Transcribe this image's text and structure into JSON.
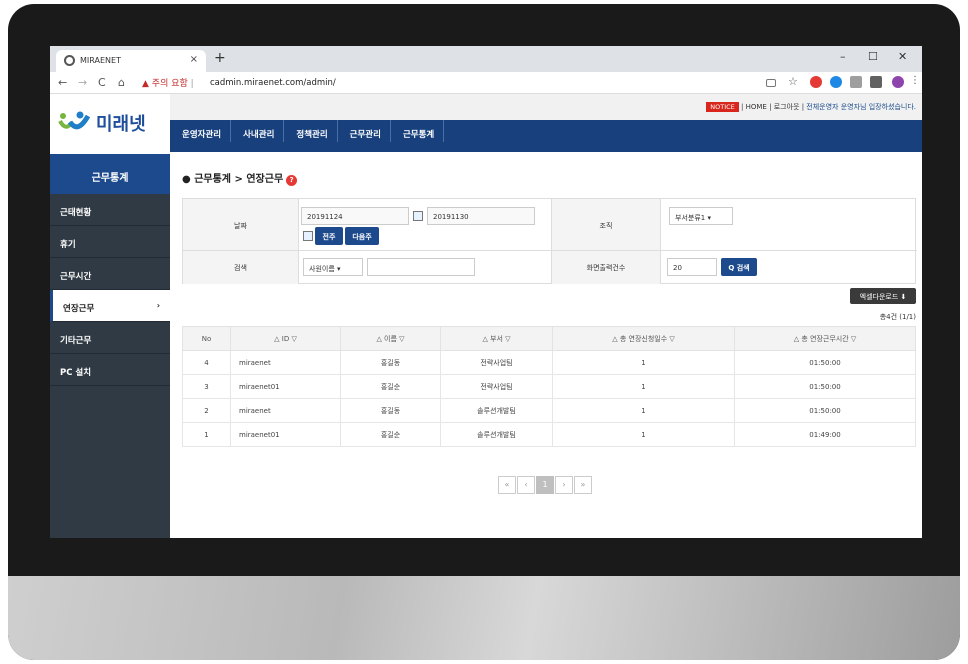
{
  "browser": {
    "tab_title": "MIRAENET",
    "tab_close": "×",
    "new_tab": "+",
    "window_controls": [
      "–",
      "☐",
      "✕"
    ],
    "nav": [
      "←",
      "→",
      "C",
      "⌂"
    ],
    "security_warning": "주의 요함",
    "url": "cadmin.miraenet.com/admin/"
  },
  "header": {
    "notice_badge": "NOTICE",
    "home_link": "HOME",
    "logout_link": "로그아웃",
    "welcome_text": "전체운영자 운영자님 입장하셨습니다.",
    "separator": "|"
  },
  "logo": {
    "text": "미래넷"
  },
  "gnb": [
    "운영자관리",
    "사내관리",
    "정책관리",
    "근무관리",
    "근무통계"
  ],
  "sidebar": {
    "title": "근무통계",
    "items": [
      {
        "label": "근태현황"
      },
      {
        "label": "휴기"
      },
      {
        "label": "근무시간"
      },
      {
        "label": "연장근무",
        "active": true,
        "chevron": "›"
      },
      {
        "label": "기타근무"
      },
      {
        "label": "PC 설치"
      }
    ]
  },
  "page": {
    "breadcrumb": "● 근무통계 > 연장근무",
    "help_icon": "?"
  },
  "filter": {
    "date_label": "날짜",
    "date_from": "20191124",
    "date_to": "20191130",
    "prev_week_button": "전주",
    "next_week_button": "다음주",
    "org_label": "조직",
    "org_select": "부서분류1",
    "search_label": "검색",
    "search_type_select": "사원이름",
    "search_value": "",
    "page_size_label": "화면출력건수",
    "page_size_value": "20",
    "search_button": "Q 검색"
  },
  "actions": {
    "excel_download": "엑셀다운로드 ⬇",
    "total_count": "총4건 (1/1)"
  },
  "table": {
    "columns": [
      "No",
      "△ ID ▽",
      "△ 이름 ▽",
      "△ 부서 ▽",
      "△ 총 연장신청일수 ▽",
      "△ 총 연장근무시간 ▽"
    ],
    "rows": [
      [
        "4",
        "miraenet",
        "홍길동",
        "전략사업팀",
        "1",
        "01:50:00"
      ],
      [
        "3",
        "miraenet01",
        "홍길순",
        "전략사업팀",
        "1",
        "01:50:00"
      ],
      [
        "2",
        "miraenet",
        "홍길동",
        "솔루션개발팀",
        "1",
        "01:50:00"
      ],
      [
        "1",
        "miraenet01",
        "홍길순",
        "솔루션개발팀",
        "1",
        "01:49:00"
      ]
    ]
  },
  "pagination": {
    "first": "«",
    "prev": "‹",
    "current": "1",
    "next": "›",
    "last": "»"
  }
}
